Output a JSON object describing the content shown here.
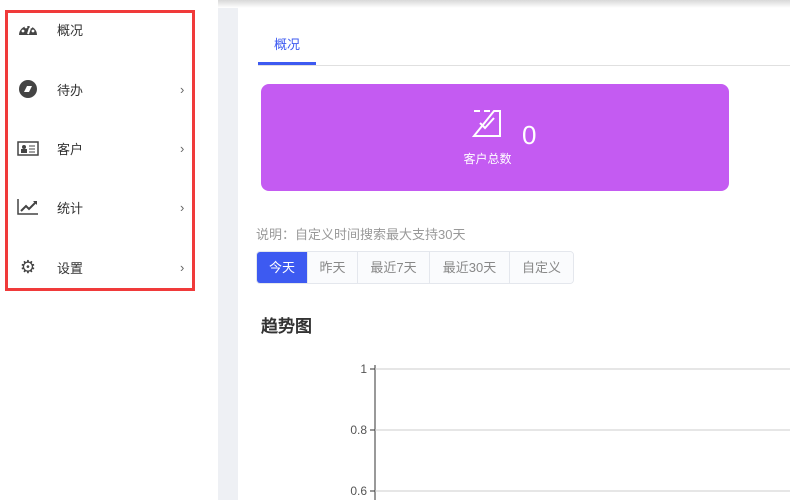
{
  "sidebar": {
    "items": [
      {
        "label": "概况",
        "icon": "dashboard-icon",
        "chevron": ""
      },
      {
        "label": "待办",
        "icon": "todo-icon",
        "chevron": "›"
      },
      {
        "label": "客户",
        "icon": "contact-card-icon",
        "chevron": "›"
      },
      {
        "label": "统计",
        "icon": "line-chart-icon",
        "chevron": "›"
      },
      {
        "label": "设置",
        "icon": "gear-icon",
        "chevron": "›"
      }
    ]
  },
  "tabs": [
    {
      "label": "概况"
    }
  ],
  "summary": {
    "label": "客户总数",
    "value": "0",
    "color": "#c45bf2"
  },
  "note": "说明：自定义时间搜索最大支持30天",
  "range_buttons": [
    {
      "label": "今天",
      "active": true
    },
    {
      "label": "昨天"
    },
    {
      "label": "最近7天"
    },
    {
      "label": "最近30天"
    },
    {
      "label": "自定义"
    }
  ],
  "chart_title": "趋势图",
  "chart_data": {
    "type": "line",
    "title": "趋势图",
    "yticks": [
      "1",
      "0.8",
      "0.6"
    ],
    "ylim": [
      0,
      1
    ],
    "series": []
  }
}
